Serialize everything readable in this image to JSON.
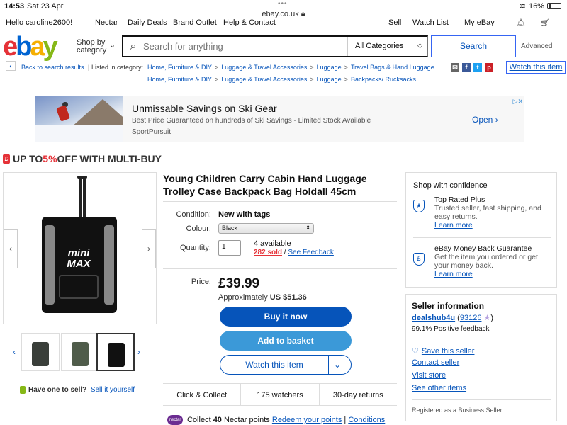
{
  "status": {
    "time": "14:53",
    "date": "Sat 23 Apr",
    "url": "ebay.co.uk",
    "battery": "16%"
  },
  "topnav": {
    "greeting": "Hello caroline2600!",
    "nectar": "Nectar",
    "deals": "Daily Deals",
    "brand": "Brand Outlet",
    "help": "Help & Contact",
    "sell": "Sell",
    "watchlist": "Watch List",
    "myebay": "My eBay"
  },
  "header": {
    "shop_by": "Shop by",
    "category": "category",
    "search_placeholder": "Search for anything",
    "all_categories": "All Categories",
    "search_button": "Search",
    "advanced": "Advanced"
  },
  "breadcrumbs": {
    "back": "Back to search results",
    "listed_in": "Listed in category:",
    "path1": [
      "Home, Furniture & DIY",
      "Luggage & Travel Accessories",
      "Luggage",
      "Travel Bags & Hand Luggage"
    ],
    "path2": [
      "Home, Furniture & DIY",
      "Luggage & Travel Accessories",
      "Luggage",
      "Backpacks/ Rucksacks"
    ],
    "watch_this_item": "Watch this item"
  },
  "ad": {
    "title": "Unmissable Savings on Ski Gear",
    "subtitle": "Best Price Guaranteed on hundreds of Ski Savings - Limited Stock Available",
    "brand": "SportPursuit",
    "open": "Open"
  },
  "multibuy": {
    "pre": "UP TO ",
    "pct": "5%",
    "post": " OFF WITH MULTI-BUY"
  },
  "product": {
    "title": "Young Children Carry Cabin Hand Luggage Trolley Case Backpack Bag Holdall 45cm",
    "condition_label": "Condition:",
    "condition_value": "New with tags",
    "colour_label": "Colour:",
    "colour_value": "Black",
    "quantity_label": "Quantity:",
    "quantity_value": "1",
    "available": "4 available",
    "sold": "282 sold",
    "sold_sep": " / ",
    "see_feedback": "See Feedback",
    "price_label": "Price:",
    "price": "£39.99",
    "approx_pre": "Approximately ",
    "approx_value": "US $51.36",
    "buy_now": "Buy it now",
    "add_basket": "Add to basket",
    "watch": "Watch this item",
    "perks": [
      "Click & Collect",
      "175 watchers",
      "30-day returns"
    ],
    "nectar_badge": "nectar",
    "nectar_pre": "Collect ",
    "nectar_points": "40",
    "nectar_post": " Nectar points",
    "redeem": "Redeem your points",
    "conditions": "Conditions",
    "sell_prompt": "Have one to sell?",
    "sell_link": "Sell it yourself",
    "image_logo": "mini MAX"
  },
  "confidence": {
    "heading": "Shop with confidence",
    "top_rated_title": "Top Rated Plus",
    "top_rated_desc": "Trusted seller, fast shipping, and easy returns.",
    "learn_more": "Learn more",
    "mbg_title": "eBay Money Back Guarantee",
    "mbg_desc": "Get the item you ordered or get your money back."
  },
  "seller": {
    "heading": "Seller information",
    "name": "dealshub4u",
    "score": "93126",
    "feedback": "99.1% Positive feedback",
    "save": "Save this seller",
    "contact": "Contact seller",
    "visit": "Visit store",
    "other": "See other items",
    "registered": "Registered as a Business Seller"
  },
  "colors": {
    "ebay_blue": "#0654ba",
    "buy_blue": "#0654ba",
    "basket_blue": "#3b99d8",
    "red": "#e53238"
  }
}
